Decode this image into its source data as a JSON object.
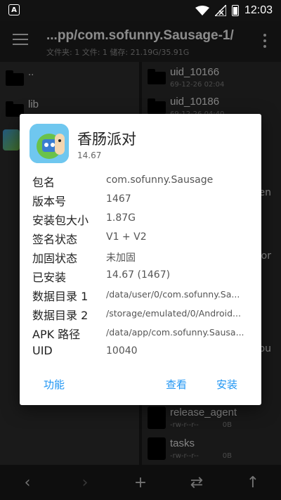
{
  "status_bar": {
    "left_icon": "A",
    "time": "12:03",
    "icons": [
      "wifi-icon",
      "signal-icon",
      "data-icon",
      "battery-icon"
    ]
  },
  "toolbar": {
    "title": "...pp/com.sofunny.Sausage-1/",
    "subtitle": "文件夹: 1  文件: 1  储存: 21.19G/35.91G"
  },
  "left_pane": {
    "items": [
      {
        "name": "..",
        "type": "folder"
      },
      {
        "name": "lib",
        "type": "folder"
      },
      {
        "name": "",
        "type": "apk"
      }
    ]
  },
  "right_pane": {
    "items": [
      {
        "name": "uid_10166",
        "meta": "69-12-26 02:04",
        "type": "folder"
      },
      {
        "name": "uid_10186",
        "meta": "69-12-26 04:40",
        "type": "folder"
      },
      {
        "name": "release_agent",
        "meta": "-rw-r--r--",
        "size": "0B",
        "type": "file"
      },
      {
        "name": "tasks",
        "meta": "-rw-r--r--",
        "size": "0B",
        "type": "file"
      }
    ],
    "edge_fragments": [
      "en",
      "or",
      "pu"
    ]
  },
  "dialog": {
    "app_name": "香肠派对",
    "version": "14.67",
    "rows": [
      {
        "label": "包名",
        "value": "com.sofunny.Sausage"
      },
      {
        "label": "版本号",
        "value": "1467"
      },
      {
        "label": "安装包大小",
        "value": "1.87G"
      },
      {
        "label": "签名状态",
        "value": "V1 + V2"
      },
      {
        "label": "加固状态",
        "value": "未加固"
      },
      {
        "label": "已安装",
        "value": "14.67 (1467)"
      },
      {
        "label": "数据目录 1",
        "value": "/data/user/0/com.sofunny.Sa..."
      },
      {
        "label": "数据目录 2",
        "value": "/storage/emulated/0/Android..."
      },
      {
        "label": "APK 路径",
        "value": "/data/app/com.sofunny.Sausa..."
      },
      {
        "label": "UID",
        "value": "10040"
      }
    ],
    "actions": {
      "function_label": "功能",
      "view_label": "查看",
      "install_label": "安装"
    },
    "accent_color": "#2196f3"
  },
  "bottom_bar": {
    "buttons": [
      "back-icon",
      "forward-icon",
      "add-icon",
      "swap-icon",
      "up-icon"
    ]
  }
}
